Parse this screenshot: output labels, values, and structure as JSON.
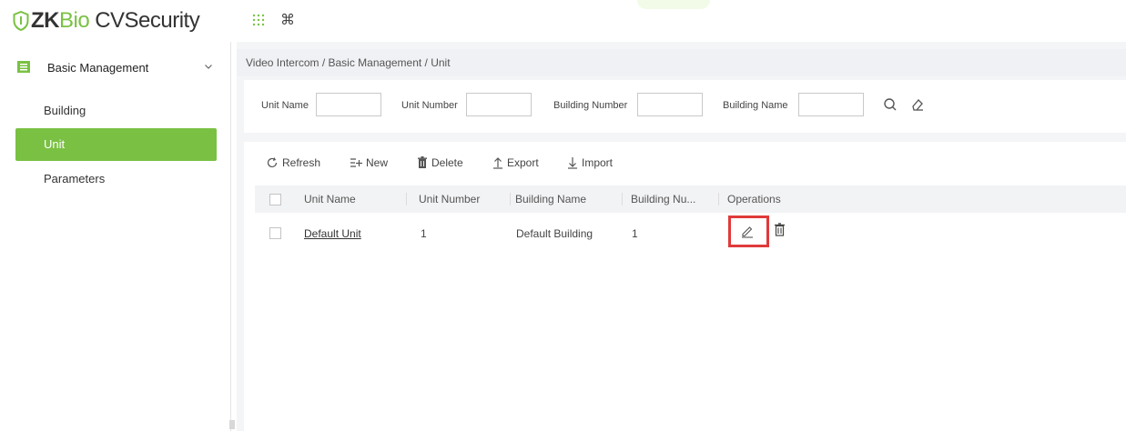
{
  "app": {
    "logo_zk": "ZK",
    "logo_bio": "Bio",
    "logo_cv": "CVSecurity",
    "brand_color": "#7ac143"
  },
  "topbar": {
    "apps_icon": "grid-dots-icon",
    "command_icon": "⌘"
  },
  "sidebar": {
    "section": {
      "label": "Basic Management",
      "icon": "list-box-icon"
    },
    "items": [
      {
        "label": "Building",
        "active": false
      },
      {
        "label": "Unit",
        "active": true
      },
      {
        "label": "Parameters",
        "active": false
      }
    ]
  },
  "breadcrumb": "Video Intercom / Basic Management / Unit",
  "filters": [
    {
      "label": "Unit Name",
      "value": ""
    },
    {
      "label": "Unit Number",
      "value": ""
    },
    {
      "label": "Building Number",
      "value": ""
    },
    {
      "label": "Building Name",
      "value": ""
    }
  ],
  "toolbar": {
    "refresh": "Refresh",
    "new": "New",
    "delete": "Delete",
    "export": "Export",
    "import": "Import"
  },
  "table": {
    "columns": [
      "Unit Name",
      "Unit Number",
      "Building Name",
      "Building Nu...",
      "Operations"
    ],
    "rows": [
      {
        "unit_name": "Default Unit",
        "unit_number": "1",
        "building_name": "Default Building",
        "building_number": "1"
      }
    ]
  },
  "highlight_color": "#e03a3a"
}
